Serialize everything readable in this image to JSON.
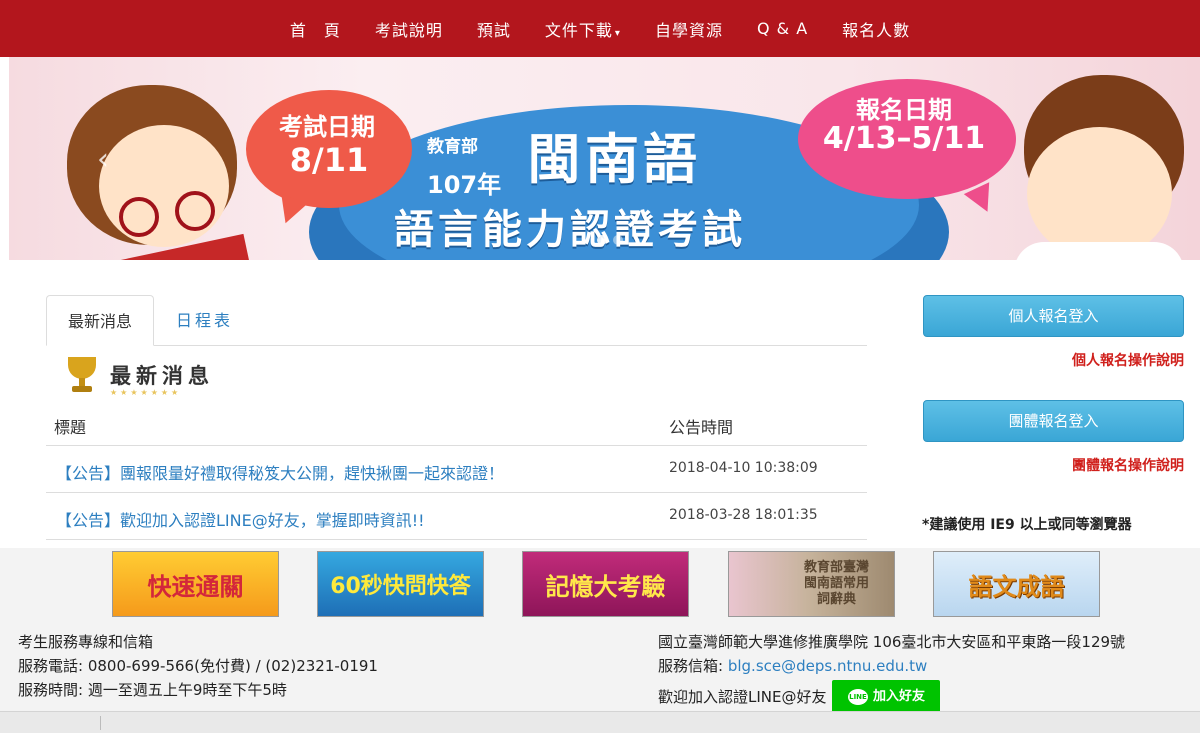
{
  "nav": {
    "items": [
      {
        "label": "首　頁"
      },
      {
        "label": "考試說明"
      },
      {
        "label": "預試"
      },
      {
        "label": "文件下載"
      },
      {
        "label": "自學資源"
      },
      {
        "label": "Q & A"
      },
      {
        "label": "報名人數"
      }
    ],
    "dropdown_caret": "▾"
  },
  "banner": {
    "exam_date_label": "考試日期",
    "exam_date": "8/11",
    "register_date_label": "報名日期",
    "register_date": "4/13–5/11",
    "ministry": "教育部",
    "year": "107年",
    "title": "閩南語",
    "subtitle": "語言能力認證考試",
    "slide_count": 2,
    "active_slide": 1
  },
  "tabs": [
    {
      "label": "最新消息",
      "active": true
    },
    {
      "label": "日程表",
      "active": false
    }
  ],
  "news": {
    "section_title": "最新消息",
    "columns": [
      "標題",
      "公告時間"
    ],
    "rows": [
      {
        "title": "【公告】團報限量好禮取得秘笈大公開，趕快揪團一起來認證！",
        "time": "2018-04-10 10:38:09"
      },
      {
        "title": "【公告】歡迎加入認證LINE@好友，掌握即時資訊!!",
        "time": "2018-03-28 18:01:35"
      }
    ]
  },
  "sidebar": {
    "personal_login": "個人報名登入",
    "personal_help": "個人報名操作說明",
    "group_login": "團體報名登入",
    "group_help": "團體報名操作說明",
    "browser_note": "*建議使用 IE9 以上或同等瀏覽器"
  },
  "ads": [
    {
      "label": "快速通關"
    },
    {
      "label": "60秒快問快答"
    },
    {
      "label": "記憶大考驗"
    },
    {
      "label": "教育部臺灣閩南語常用詞辭典"
    },
    {
      "label": "語文成語"
    }
  ],
  "footer": {
    "service_title": "考生服務專線和信箱",
    "phone_label": "服務電話:",
    "phone": "0800-699-566(免付費) / (02)2321-0191",
    "hours_label": "服務時間:",
    "hours": "週一至週五上午9時至下午5時",
    "org": "國立臺灣師範大學進修推廣學院",
    "address": "106臺北市大安區和平東路一段129號",
    "email_label": "服務信箱:",
    "email": "blg.sce@deps.ntnu.edu.tw",
    "line_text": "歡迎加入認證LINE@好友",
    "line_button": "加入好友",
    "line_icon_text": "LINE"
  },
  "colors": {
    "nav_bg": "#b3161d",
    "link": "#2d7fc0",
    "button": "#3aa6d6",
    "help_red": "#d0201c",
    "line_green": "#00c300"
  }
}
